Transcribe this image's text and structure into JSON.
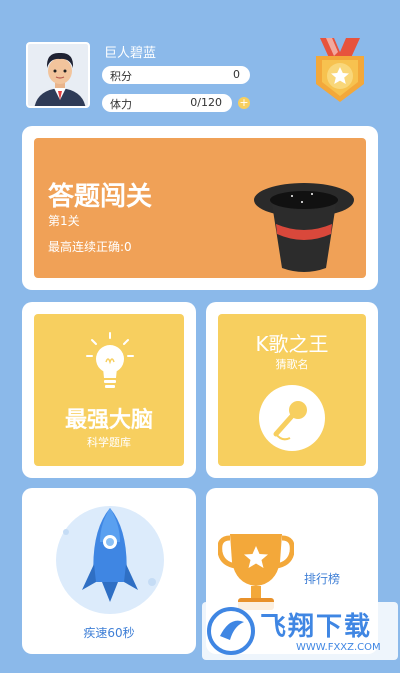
{
  "profile": {
    "name": "巨人碧蓝",
    "points_label": "积分",
    "points_value": "0",
    "stamina_label": "体力",
    "stamina_value": "0/120",
    "plus": "+"
  },
  "cards": {
    "challenge": {
      "title": "答题闯关",
      "level": "第1关",
      "streak": "最高连续正确:0"
    },
    "brain": {
      "title": "最强大脑",
      "subtitle": "科学题库"
    },
    "karaoke": {
      "title": "K歌之王",
      "subtitle": "猜歌名"
    },
    "speed": {
      "title": "疾速60秒"
    },
    "ranking": {
      "title": "排行榜"
    }
  },
  "watermark": {
    "text": "飞翔下载",
    "url": "WWW.FXXZ.COM"
  },
  "colors": {
    "background": "#8bb9ea",
    "orange": "#f0a157",
    "yellow": "#f7cf5f",
    "light_blue": "#dcebfb"
  },
  "icons": [
    "medal-icon",
    "top-hat-icon",
    "light-bulb-icon",
    "microphone-icon",
    "rocket-icon",
    "trophy-icon"
  ]
}
